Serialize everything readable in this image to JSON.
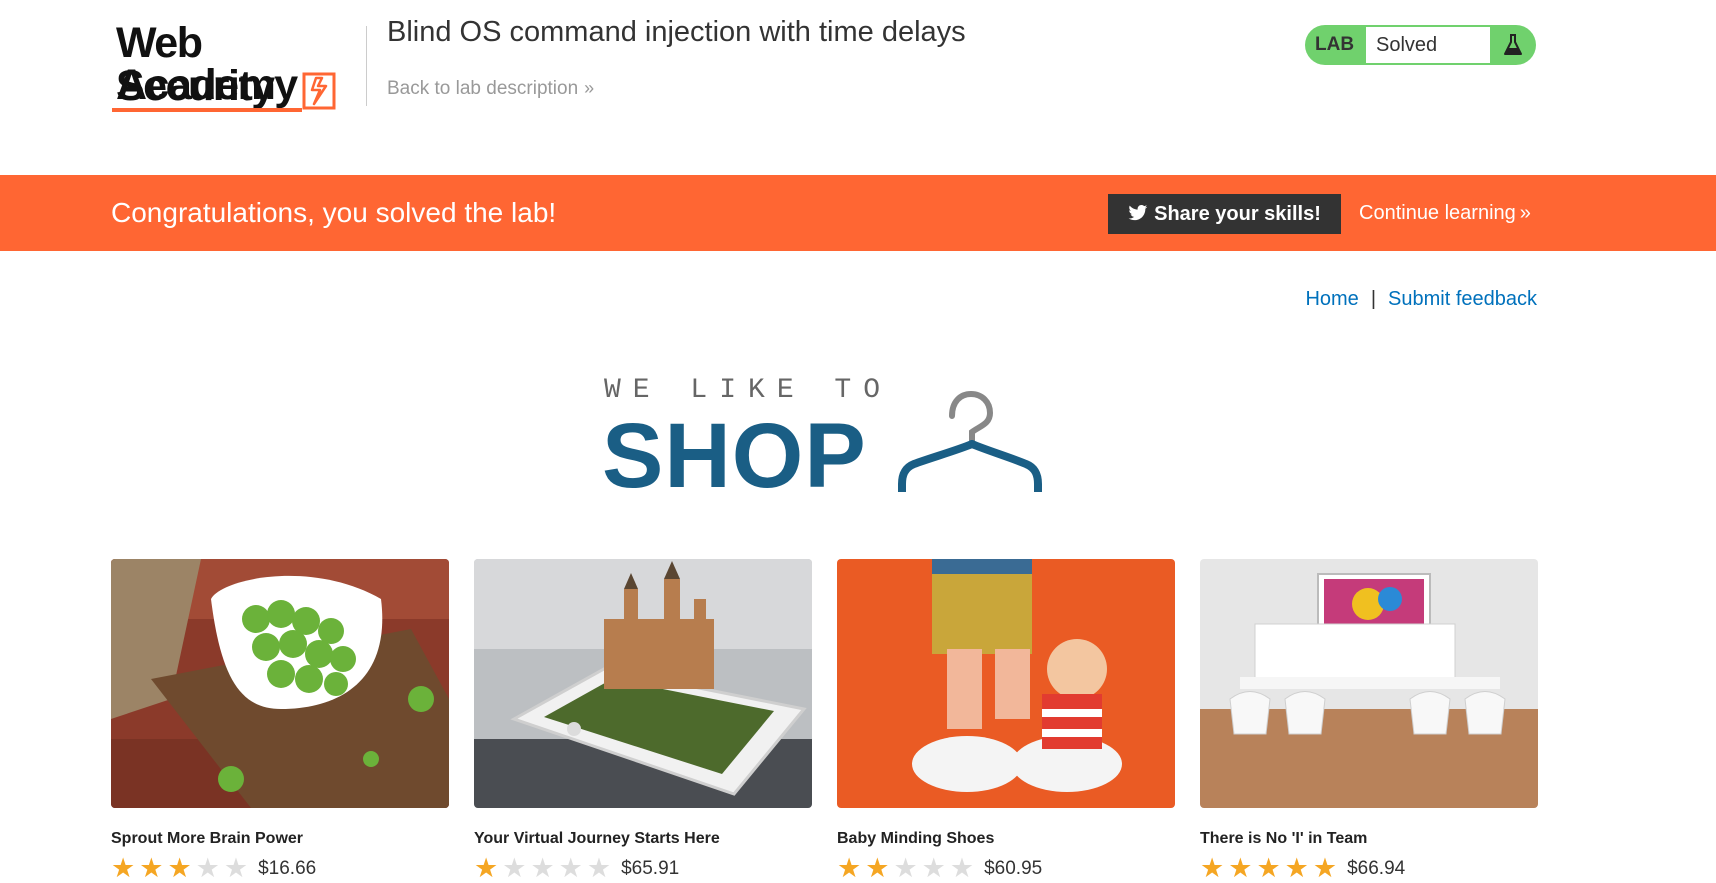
{
  "header": {
    "logo_line1": "Web Security",
    "logo_line2": "Academy",
    "lab_title": "Blind OS command injection with time delays",
    "back_link": "Back to lab description",
    "lab_badge": "LAB",
    "lab_status": "Solved"
  },
  "banner": {
    "message": "Congratulations, you solved the lab!",
    "share_label": "Share your skills!",
    "continue_label": "Continue learning"
  },
  "nav": {
    "home": "Home",
    "separator": "|",
    "feedback": "Submit feedback"
  },
  "shop_logo": {
    "tagline": "WE LIKE TO",
    "word": "SHOP"
  },
  "products": [
    {
      "name": "Sprout More Brain Power",
      "rating": 3,
      "price": "$16.66"
    },
    {
      "name": "Your Virtual Journey Starts Here",
      "rating": 1,
      "price": "$65.91"
    },
    {
      "name": "Baby Minding Shoes",
      "rating": 2,
      "price": "$60.95"
    },
    {
      "name": "There is No 'I' in Team",
      "rating": 5,
      "price": "$66.94"
    }
  ],
  "colors": {
    "accent": "#ff6633",
    "link": "#0071bc",
    "solved": "#70d16d",
    "shop_blue": "#1a5e85"
  }
}
